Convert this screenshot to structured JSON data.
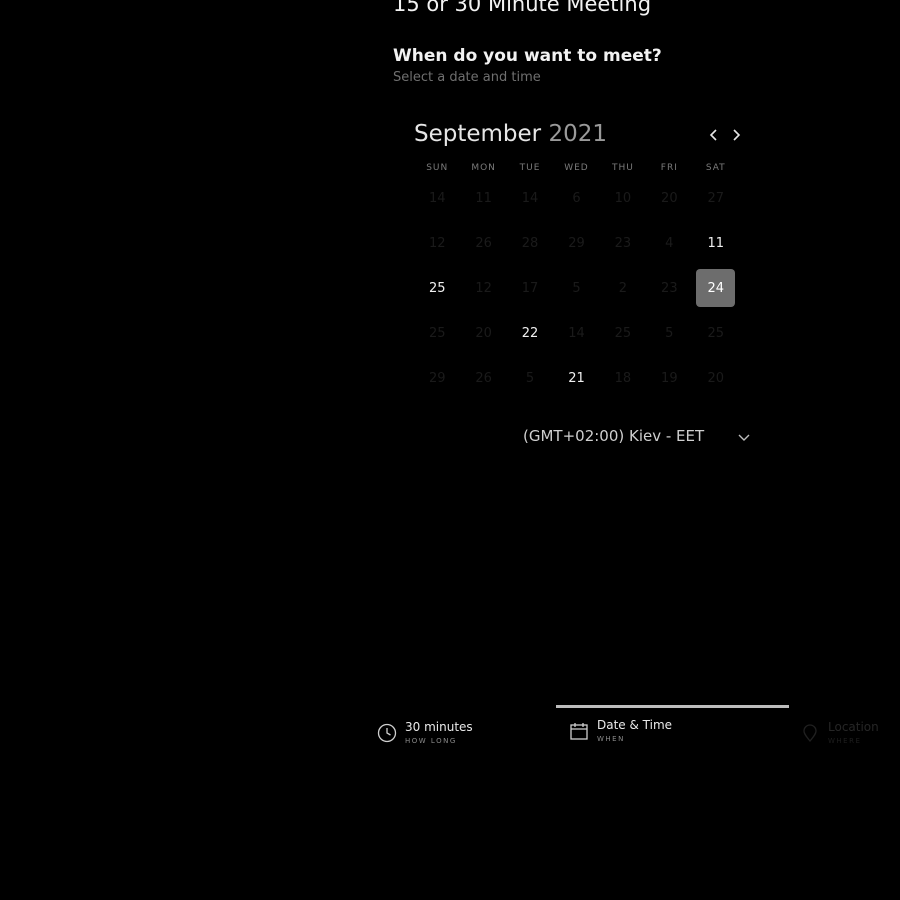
{
  "header": {
    "title": "15 or 30 Minute Meeting",
    "subtitle": "When do you want to meet?",
    "hint": "Select a date and time"
  },
  "calendar": {
    "month": "September",
    "year": "2021",
    "weekdays": [
      "SUN",
      "MON",
      "TUE",
      "WED",
      "THU",
      "FRI",
      "SAT"
    ],
    "weeks": [
      [
        "14",
        "11",
        "14",
        "6",
        "10",
        "20",
        "27"
      ],
      [
        "12",
        "26",
        "28",
        "29",
        "23",
        "4",
        "11"
      ],
      [
        "25",
        "12",
        "17",
        "5",
        "2",
        "23",
        "24"
      ],
      [
        "25",
        "20",
        "22",
        "14",
        "25",
        "5",
        "25"
      ],
      [
        "29",
        "26",
        "5",
        "21",
        "18",
        "19",
        "20"
      ]
    ],
    "available": [
      [
        1,
        6
      ],
      [
        2,
        0
      ],
      [
        2,
        6
      ],
      [
        3,
        2
      ],
      [
        4,
        3
      ]
    ],
    "selected": [
      2,
      6
    ]
  },
  "timezone": {
    "label": "(GMT+02:00) Kiev - EET"
  },
  "tabs": [
    {
      "label": "30 minutes",
      "sub": "HOW LONG",
      "icon": "clock-icon"
    },
    {
      "label": "Date & Time",
      "sub": "WHEN",
      "icon": "calendar-icon"
    },
    {
      "label": "Location",
      "sub": "WHERE",
      "icon": "location-icon"
    }
  ],
  "colors": {
    "background": "#000000",
    "selected_day": "#6d6d6d",
    "active_tab_line": "#bdbdbd"
  }
}
